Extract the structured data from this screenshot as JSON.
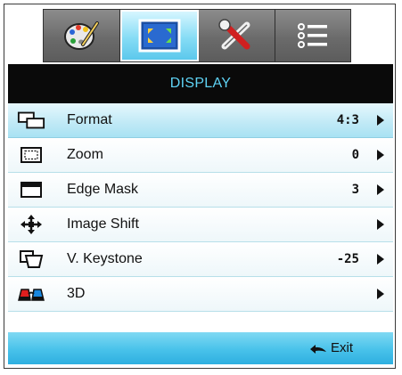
{
  "tabs": [
    {
      "name": "image-settings",
      "icon": "palette-icon"
    },
    {
      "name": "display",
      "icon": "display-screen-icon",
      "active": true
    },
    {
      "name": "setup",
      "icon": "tools-icon"
    },
    {
      "name": "options",
      "icon": "list-icon"
    }
  ],
  "header": {
    "title": "DISPLAY"
  },
  "rows": [
    {
      "label": "Format",
      "value": "4:3",
      "icon": "format-icon"
    },
    {
      "label": "Zoom",
      "value": "0",
      "icon": "zoom-icon"
    },
    {
      "label": "Edge Mask",
      "value": "3",
      "icon": "edge-mask-icon"
    },
    {
      "label": "Image Shift",
      "value": "",
      "icon": "move-arrows-icon"
    },
    {
      "label": "V. Keystone",
      "value": "-25",
      "icon": "keystone-icon"
    },
    {
      "label": "3D",
      "value": "",
      "icon": "3d-glasses-icon"
    }
  ],
  "footer": {
    "exit_label": "Exit"
  },
  "colors": {
    "accent": "#5fd3f5",
    "header_bg": "#0a0a0a",
    "bar": "#48c2ea"
  }
}
